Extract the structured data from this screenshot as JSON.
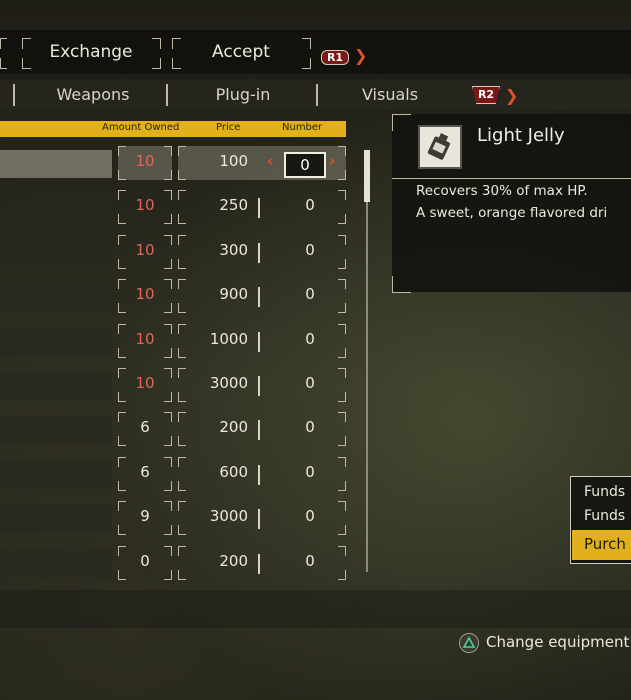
{
  "top_tabs": [
    "Exchange",
    "Accept"
  ],
  "top_tabs_button": "R1",
  "sub_tabs": [
    "Weapons",
    "Plug-in",
    "Visuals"
  ],
  "sub_tabs_button": "R2",
  "table": {
    "headers": [
      "Amount Owned",
      "Price",
      "Number"
    ],
    "rows": [
      {
        "owned": "10",
        "price": "100",
        "number": "0",
        "owned_max": true,
        "selected": true
      },
      {
        "owned": "10",
        "price": "250",
        "number": "0",
        "owned_max": true
      },
      {
        "owned": "10",
        "price": "300",
        "number": "0",
        "owned_max": true
      },
      {
        "owned": "10",
        "price": "900",
        "number": "0",
        "owned_max": true
      },
      {
        "owned": "10",
        "price": "1000",
        "number": "0",
        "owned_max": true
      },
      {
        "owned": "10",
        "price": "3000",
        "number": "0",
        "owned_max": true
      },
      {
        "owned": "6",
        "price": "200",
        "number": "0",
        "owned_max": false
      },
      {
        "owned": "6",
        "price": "600",
        "number": "0",
        "owned_max": false
      },
      {
        "owned": "9",
        "price": "3000",
        "number": "0",
        "owned_max": false
      },
      {
        "owned": "0",
        "price": "200",
        "number": "0",
        "owned_max": false
      }
    ]
  },
  "detail": {
    "name": "Light Jelly",
    "description_lines": [
      "Recovers 30% of max HP.",
      "A sweet, orange flavored dri"
    ]
  },
  "funds_panel": {
    "line1": "Funds",
    "line2": "Funds",
    "purchase_label": "Purch"
  },
  "footer_hint": {
    "icon": "triangle-button-icon",
    "text": "Change equipment."
  },
  "colors": {
    "accent_yellow": "#e2b01a",
    "max_owned_red": "#e0665a",
    "chevron_orange": "#e0502a"
  }
}
